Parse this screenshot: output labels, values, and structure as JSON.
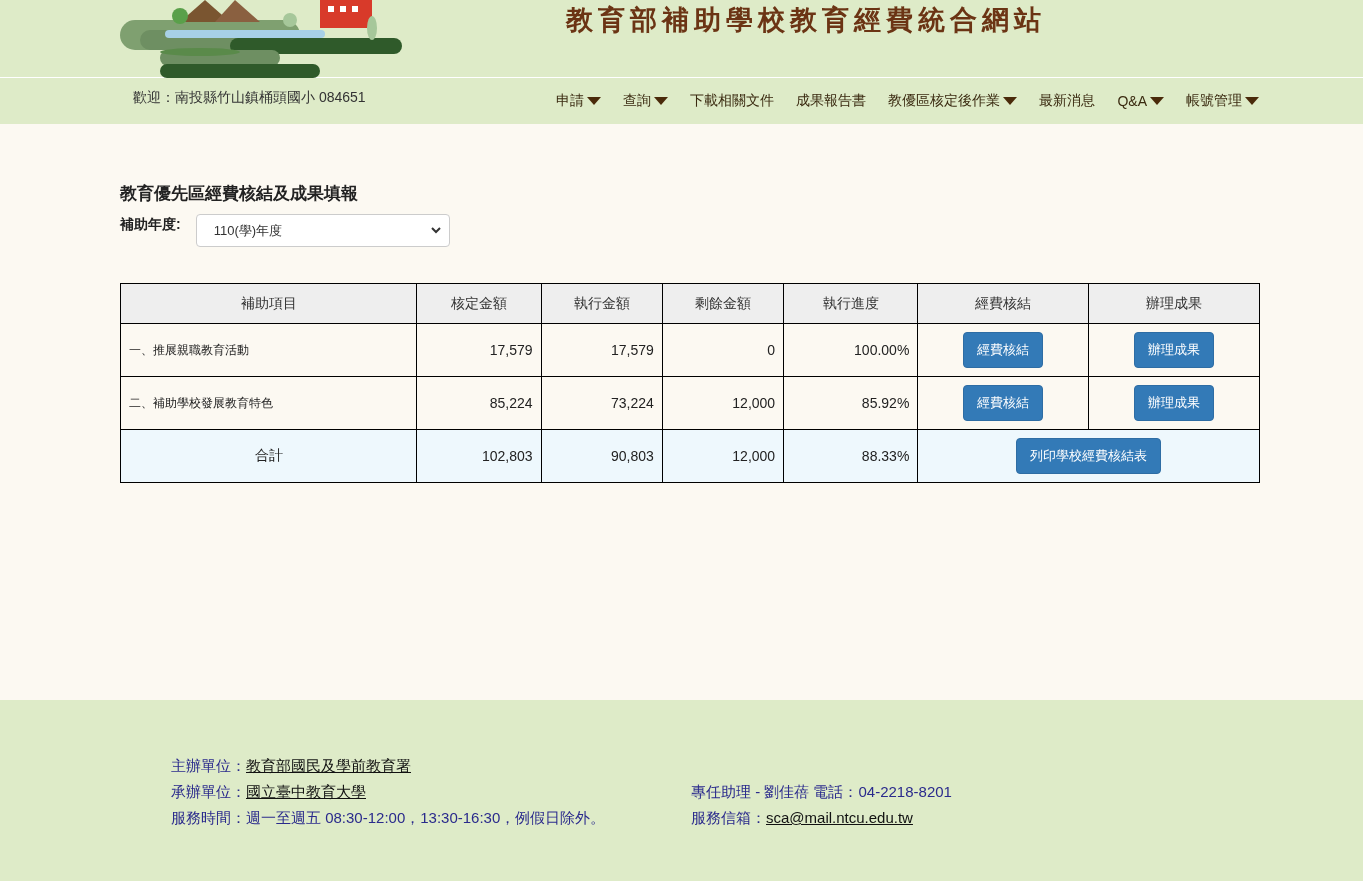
{
  "header": {
    "site_title": "教育部補助學校教育經費統合網站"
  },
  "nav": {
    "welcome": "歡迎：南投縣竹山鎮桶頭國小 084651",
    "items": [
      {
        "label": "申請",
        "dropdown": true
      },
      {
        "label": "查詢",
        "dropdown": true
      },
      {
        "label": "下載相關文件",
        "dropdown": false
      },
      {
        "label": "成果報告書",
        "dropdown": false
      },
      {
        "label": "教優區核定後作業",
        "dropdown": true
      },
      {
        "label": "最新消息",
        "dropdown": false
      },
      {
        "label": "Q&A",
        "dropdown": true
      },
      {
        "label": "帳號管理",
        "dropdown": true
      }
    ]
  },
  "page": {
    "heading": "教育優先區經費核結及成果填報",
    "year_label": "補助年度:",
    "year_value": "110(學)年度"
  },
  "table": {
    "columns": [
      "補助項目",
      "核定金額",
      "執行金額",
      "剩餘金額",
      "執行進度",
      "經費核結",
      "辦理成果"
    ],
    "rows": [
      {
        "item": "一、推展親職教育活動",
        "approved": "17,579",
        "executed": "17,579",
        "remaining": "0",
        "progress": "100.00%",
        "settle_button": "經費核結",
        "result_button": "辦理成果"
      },
      {
        "item": "二、補助學校發展教育特色",
        "approved": "85,224",
        "executed": "73,224",
        "remaining": "12,000",
        "progress": "85.92%",
        "settle_button": "經費核結",
        "result_button": "辦理成果"
      }
    ],
    "total": {
      "label": "合計",
      "approved": "102,803",
      "executed": "90,803",
      "remaining": "12,000",
      "progress": "88.33%",
      "print_button": "列印學校經費核結表"
    }
  },
  "footer": {
    "left": [
      {
        "label": "主辦單位：",
        "link": "教育部國民及學前教育署"
      },
      {
        "label": "承辦單位：",
        "link": "國立臺中教育大學"
      },
      {
        "label": "服務時間：週一至週五 08:30-12:00，13:30-16:30，例假日除外。"
      }
    ],
    "right": [
      {
        "label": "專任助理 - 劉佳蓓 電話：04-2218-8201"
      },
      {
        "label": "服務信箱：",
        "link": "sca@mail.ntcu.edu.tw"
      }
    ]
  }
}
